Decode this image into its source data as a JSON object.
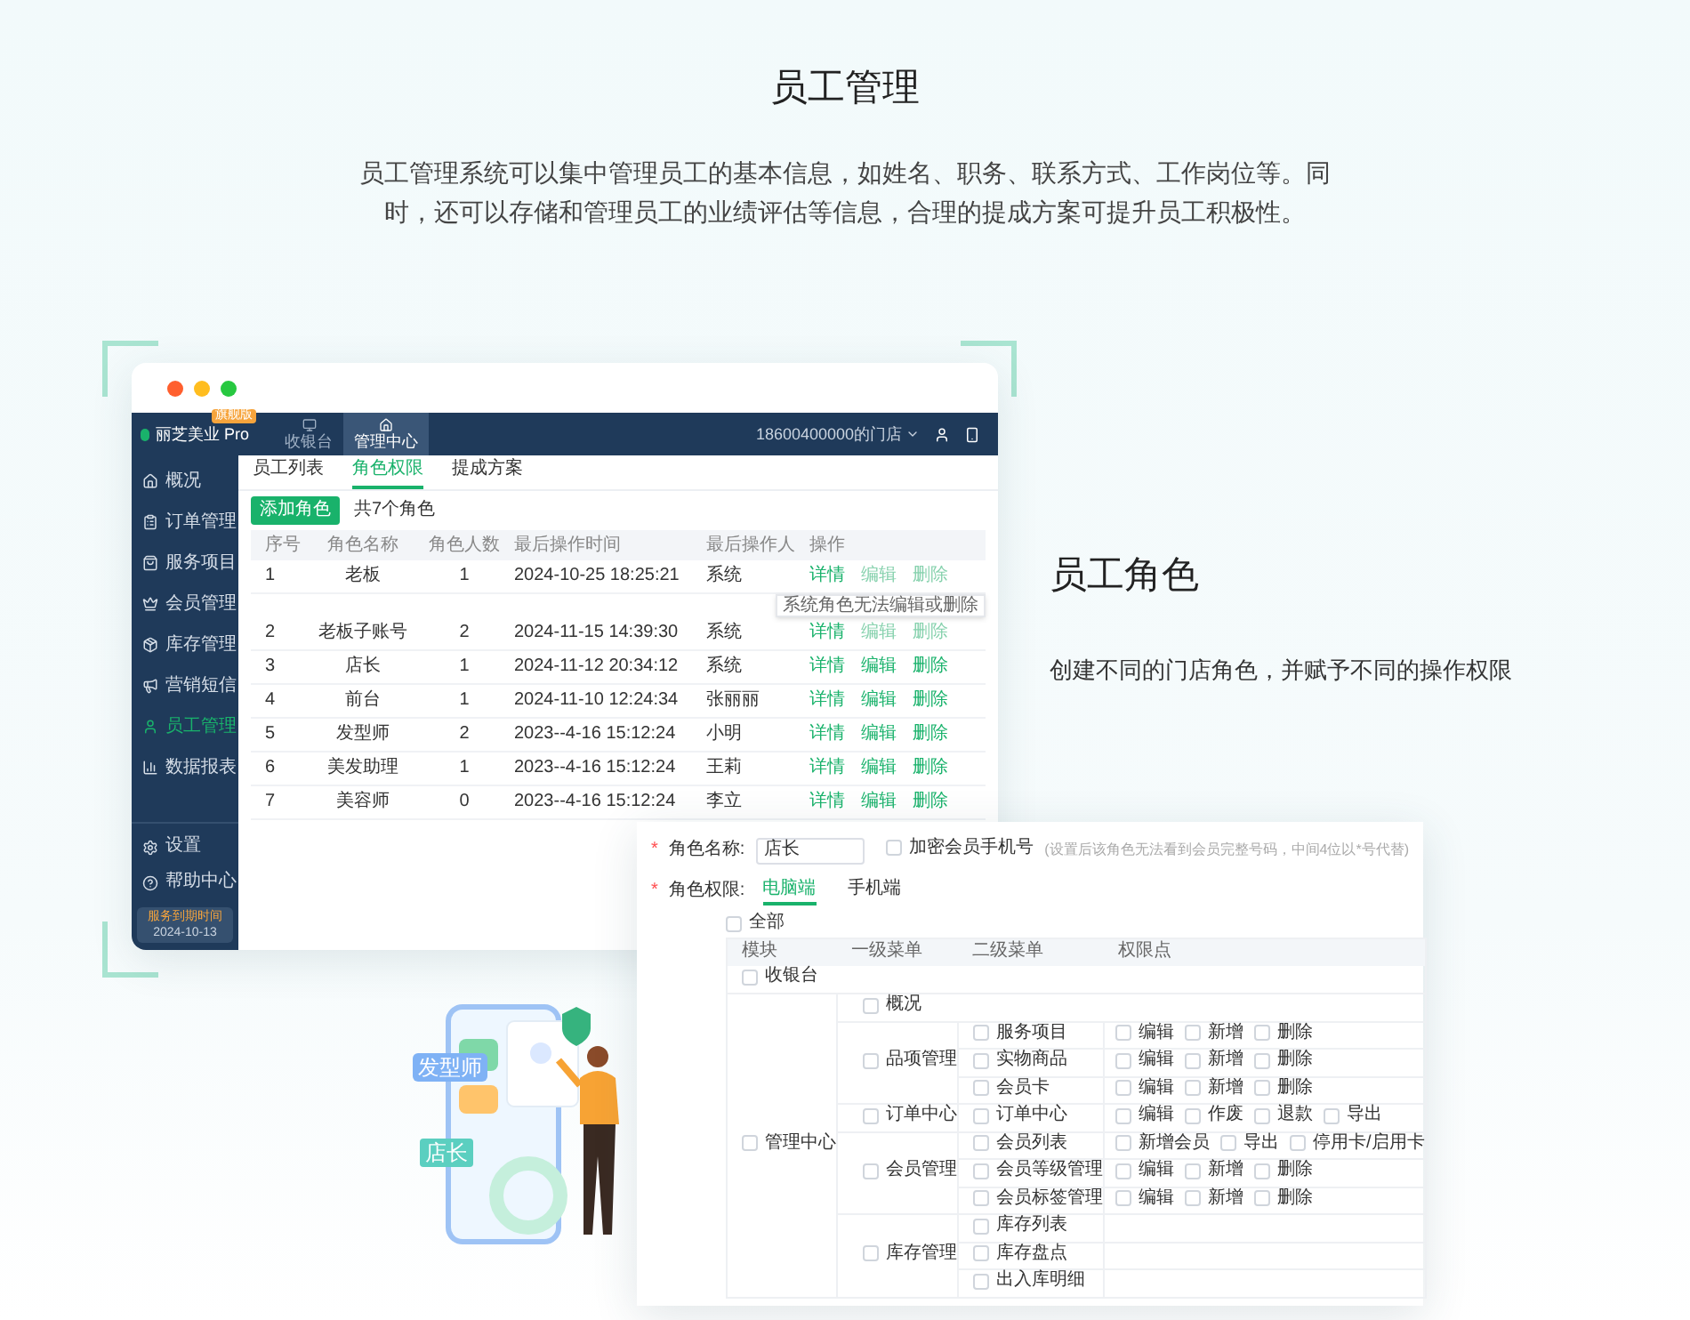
{
  "page": {
    "title": "员工管理",
    "description": "员工管理系统可以集中管理员工的基本信息，如姓名、职务、联系方式、工作岗位等。同时，还可以存储和管理员工的业绩评估等信息，合理的提成方案可提升员工积极性。"
  },
  "feature": {
    "title": "员工角色",
    "description": "创建不同的门店角色，并赋予不同的操作权限"
  },
  "app": {
    "brand": "丽芝美业 Pro",
    "badge": "旗舰版",
    "nav": [
      {
        "label": "收银台",
        "selected": false
      },
      {
        "label": "管理中心",
        "selected": true
      }
    ],
    "store": "18600400000的门店",
    "sidebar": [
      {
        "label": "概况",
        "selected": false
      },
      {
        "label": "订单管理",
        "selected": false
      },
      {
        "label": "服务项目",
        "selected": false
      },
      {
        "label": "会员管理",
        "selected": false
      },
      {
        "label": "库存管理",
        "selected": false
      },
      {
        "label": "营销短信",
        "selected": false
      },
      {
        "label": "员工管理",
        "selected": true
      },
      {
        "label": "数据报表",
        "selected": false
      }
    ],
    "sidebar_footer": [
      {
        "label": "设置"
      },
      {
        "label": "帮助中心"
      }
    ],
    "expiry": {
      "label": "服务到期时间",
      "date": "2024-10-13"
    },
    "tabs": [
      {
        "label": "员工列表",
        "selected": false
      },
      {
        "label": "角色权限",
        "selected": true
      },
      {
        "label": "提成方案",
        "selected": false
      }
    ],
    "add_button": "添加角色",
    "count": "共7个角色",
    "table": {
      "columns": [
        "序号",
        "角色名称",
        "角色人数",
        "最后操作时间",
        "最后操作人",
        "操作"
      ],
      "rows": [
        {
          "cells": [
            "1",
            "老板",
            "1",
            "2024-10-25 18:25:21",
            "系统"
          ],
          "actions": [
            {
              "label": "详情",
              "disabled": false
            },
            {
              "label": "编辑",
              "disabled": true
            },
            {
              "label": "删除",
              "disabled": true
            }
          ]
        },
        {
          "cells": [
            "2",
            "老板子账号",
            "2",
            "2024-11-15 14:39:30",
            "系统"
          ],
          "actions": [
            {
              "label": "详情",
              "disabled": false
            },
            {
              "label": "编辑",
              "disabled": true
            },
            {
              "label": "删除",
              "disabled": true
            }
          ]
        },
        {
          "cells": [
            "3",
            "店长",
            "1",
            "2024-11-12 20:34:12",
            "系统"
          ],
          "actions": [
            {
              "label": "详情",
              "disabled": false
            },
            {
              "label": "编辑",
              "disabled": false
            },
            {
              "label": "删除",
              "disabled": false
            }
          ]
        },
        {
          "cells": [
            "4",
            "前台",
            "1",
            "2024-11-10 12:24:34",
            "张丽丽"
          ],
          "actions": [
            {
              "label": "详情",
              "disabled": false
            },
            {
              "label": "编辑",
              "disabled": false
            },
            {
              "label": "删除",
              "disabled": false
            }
          ]
        },
        {
          "cells": [
            "5",
            "发型师",
            "2",
            "2023--4-16 15:12:24",
            "小明"
          ],
          "actions": [
            {
              "label": "详情",
              "disabled": false
            },
            {
              "label": "编辑",
              "disabled": false
            },
            {
              "label": "删除",
              "disabled": false
            }
          ]
        },
        {
          "cells": [
            "6",
            "美发助理",
            "1",
            "2023--4-16 15:12:24",
            "王莉"
          ],
          "actions": [
            {
              "label": "详情",
              "disabled": false
            },
            {
              "label": "编辑",
              "disabled": false
            },
            {
              "label": "删除",
              "disabled": false
            }
          ]
        },
        {
          "cells": [
            "7",
            "美容师",
            "0",
            "2023--4-16 15:12:24",
            "李立"
          ],
          "actions": [
            {
              "label": "详情",
              "disabled": false
            },
            {
              "label": "编辑",
              "disabled": false
            },
            {
              "label": "删除",
              "disabled": false
            }
          ]
        }
      ]
    },
    "tooltip": "系统角色无法编辑或删除"
  },
  "role_form": {
    "name_field": {
      "mark": "*",
      "label": "角色名称:",
      "value": "店长"
    },
    "hide_phone": {
      "label": "加密会员手机号",
      "checked": false,
      "hint": "(设置后该角色无法看到会员完整号码，中间4位以*号代替)"
    },
    "perm_field": {
      "mark": "*",
      "label": "角色权限:"
    },
    "tabs": [
      {
        "label": "电脑端",
        "selected": true
      },
      {
        "label": "手机端",
        "selected": false
      }
    ],
    "select_all": {
      "label": "全部",
      "checked": false
    },
    "columns": [
      "模块",
      "一级菜单",
      "二级菜单",
      "权限点"
    ],
    "modules": [
      {
        "label": "收银台",
        "checked": false
      },
      {
        "label": "管理中心",
        "checked": false,
        "menus": [
          {
            "label": "概况",
            "checked": false
          },
          {
            "label": "品项管理",
            "checked": false,
            "submenus": [
              {
                "label": "服务项目",
                "checked": false,
                "perms": [
                  {
                    "label": "编辑",
                    "checked": false
                  },
                  {
                    "label": "新增",
                    "checked": false
                  },
                  {
                    "label": "删除",
                    "checked": false
                  }
                ]
              },
              {
                "label": "实物商品",
                "checked": false,
                "perms": [
                  {
                    "label": "编辑",
                    "checked": false
                  },
                  {
                    "label": "新增",
                    "checked": false
                  },
                  {
                    "label": "删除",
                    "checked": false
                  }
                ]
              },
              {
                "label": "会员卡",
                "checked": false,
                "perms": [
                  {
                    "label": "编辑",
                    "checked": false
                  },
                  {
                    "label": "新增",
                    "checked": false
                  },
                  {
                    "label": "删除",
                    "checked": false
                  }
                ]
              }
            ]
          },
          {
            "label": "订单中心",
            "checked": false,
            "submenus": [
              {
                "label": "订单中心",
                "checked": false,
                "perms": [
                  {
                    "label": "编辑",
                    "checked": false
                  },
                  {
                    "label": "作废",
                    "checked": false
                  },
                  {
                    "label": "退款",
                    "checked": false
                  },
                  {
                    "label": "导出",
                    "checked": false
                  }
                ]
              }
            ]
          },
          {
            "label": "会员管理",
            "checked": false,
            "submenus": [
              {
                "label": "会员列表",
                "checked": false,
                "perms": [
                  {
                    "label": "新增会员",
                    "checked": false
                  },
                  {
                    "label": "导出",
                    "checked": false
                  },
                  {
                    "label": "停用卡/启用卡",
                    "checked": false
                  }
                ]
              },
              {
                "label": "会员等级管理",
                "checked": false,
                "perms": [
                  {
                    "label": "编辑",
                    "checked": false
                  },
                  {
                    "label": "新增",
                    "checked": false
                  },
                  {
                    "label": "删除",
                    "checked": false
                  }
                ]
              },
              {
                "label": "会员标签管理",
                "checked": false,
                "perms": [
                  {
                    "label": "编辑",
                    "checked": false
                  },
                  {
                    "label": "新增",
                    "checked": false
                  },
                  {
                    "label": "删除",
                    "checked": false
                  }
                ]
              }
            ]
          },
          {
            "label": "库存管理",
            "checked": false,
            "submenus": [
              {
                "label": "库存列表",
                "checked": false
              },
              {
                "label": "库存盘点",
                "checked": false
              },
              {
                "label": "出入库明细",
                "checked": false
              }
            ]
          }
        ]
      }
    ]
  },
  "illustration": {
    "tags": [
      "发型师",
      "店长"
    ]
  }
}
